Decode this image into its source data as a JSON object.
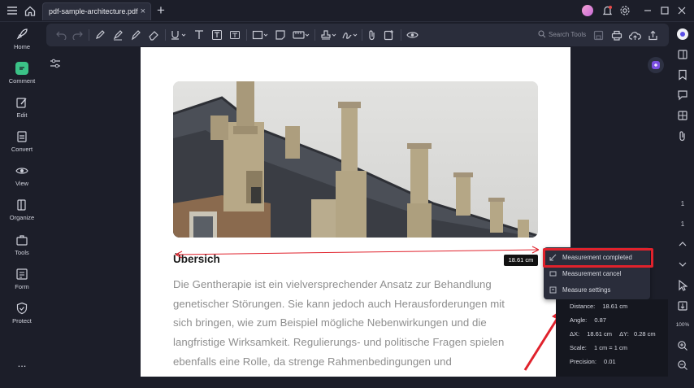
{
  "titlebar": {
    "tab_label": "pdf-sample-architecture.pdf",
    "tab_close": "×",
    "add_tab": "+"
  },
  "sidebar": {
    "items": [
      {
        "label": "Home",
        "icon": "rocket-icon"
      },
      {
        "label": "Comment",
        "icon": "comment-icon"
      },
      {
        "label": "Edit",
        "icon": "edit-icon"
      },
      {
        "label": "Convert",
        "icon": "convert-icon"
      },
      {
        "label": "View",
        "icon": "eye-icon"
      },
      {
        "label": "Organize",
        "icon": "organize-icon"
      },
      {
        "label": "Tools",
        "icon": "toolbox-icon"
      },
      {
        "label": "Form",
        "icon": "form-icon"
      },
      {
        "label": "Protect",
        "icon": "shield-icon"
      }
    ],
    "more": "..."
  },
  "toolbar": {
    "search_placeholder": "Search Tools"
  },
  "document": {
    "heading": "Übersich",
    "paragraph_lines": [
      "Die Gentherapie ist ein vielversprechender Ansatz zur Behandlung",
      "genetischer Störungen. Sie kann jedoch auch Herausforderungen mit",
      "sich bringen, wie zum Beispiel mögliche Nebenwirkungen und die",
      "langfristige Wirksamkeit. Regulierungs- und politische Fragen spielen",
      "ebenfalls eine Rolle, da strenge Rahmenbedingungen und"
    ]
  },
  "measurement": {
    "tag": "18.61 cm",
    "menu": [
      {
        "label": "Measurement completed",
        "icon": "measure-complete-icon"
      },
      {
        "label": "Measurement cancel",
        "icon": "measure-cancel-icon"
      },
      {
        "label": "Measure settings",
        "icon": "settings-icon"
      }
    ],
    "panel": {
      "distance_label": "Distance:",
      "distance_value": "18.61 cm",
      "angle_label": "Angle:",
      "angle_value": "0.87",
      "dx_label": "ΔX:",
      "dx_value": "18.61 cm",
      "dy_label": "ΔY:",
      "dy_value": "0.28 cm",
      "scale_label": "Scale:",
      "scale_value": "1 cm = 1 cm",
      "precision_label": "Precision:",
      "precision_value": "0.01"
    }
  },
  "right_rail": {
    "page_current": "1",
    "page_total": "1",
    "zoom": "100%"
  },
  "colors": {
    "background": "#1c1e29",
    "toolbar": "#2a2d3b",
    "accent_green": "#3bc287",
    "highlight_red": "#e0222c"
  }
}
